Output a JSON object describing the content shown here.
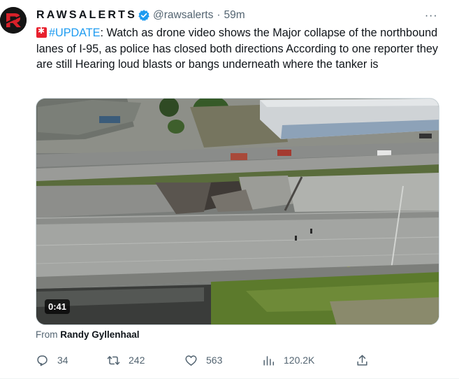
{
  "author": {
    "name": "RAWSALERTS",
    "handle": "@rawsalerts",
    "separator": "·",
    "time": "59m"
  },
  "tweet": {
    "hashtag": "#UPDATE",
    "body": ": Watch as drone video shows the Major collapse of the northbound lanes of I-95, as police has closed both directions According to one reporter they are still Hearing loud blasts or bangs underneath where the tanker is"
  },
  "media": {
    "duration": "0:41"
  },
  "attribution": {
    "prefix": "From",
    "source_name": "Randy Gyllenhaal"
  },
  "actions": {
    "replies": "34",
    "retweets": "242",
    "likes": "563",
    "views": "120.2K"
  },
  "icons": {
    "avatar": "rawsalerts-logo",
    "verified": "verified-badge-icon",
    "more": "more-horizontal-icon",
    "emoji": "rotating-light-emoji",
    "reply": "reply-icon",
    "retweet": "retweet-icon",
    "like": "heart-icon",
    "views": "views-chart-icon",
    "share": "share-icon"
  },
  "colors": {
    "accent": "#1d9bf0",
    "text": "#0f1419",
    "muted": "#536471",
    "verified": "#1d9bf0"
  }
}
